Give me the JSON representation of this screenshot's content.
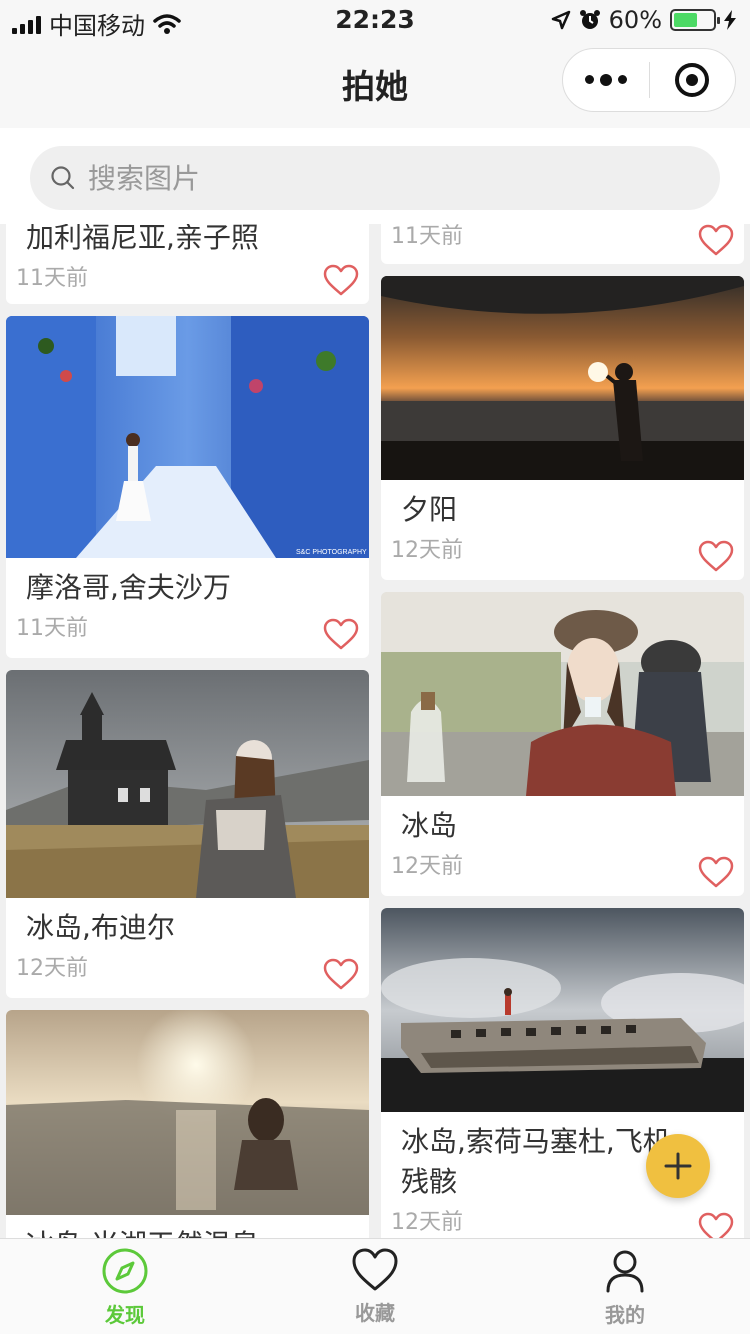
{
  "status_bar": {
    "carrier": "中国移动",
    "time": "22:23",
    "battery": "60%",
    "battery_level": 0.6
  },
  "navbar": {
    "title": "拍她"
  },
  "search": {
    "placeholder": "搜索图片"
  },
  "feed": {
    "left": [
      {
        "caption": "加利福尼亚,亲子照",
        "time": "11天前",
        "image": "partial-top"
      },
      {
        "caption": "摩洛哥,舍夫沙万",
        "time": "11天前",
        "image": "blue-city-girl-in-white-dress",
        "watermark": "S&C PHOTOGRAPHY"
      },
      {
        "caption": "冰岛,布迪尔",
        "time": "12天前",
        "image": "black-church-woman-in-sweater"
      },
      {
        "caption": "冰岛,米湖天然温泉",
        "time": "",
        "image": "woman-in-hot-spring-sunset"
      }
    ],
    "right": [
      {
        "caption": "",
        "time": "11天前",
        "image": "partial-top"
      },
      {
        "caption": "夕阳",
        "time": "12天前",
        "image": "sunset-silhouette-holding-sun"
      },
      {
        "caption": "冰岛",
        "time": "12天前",
        "image": "girl-in-cap-drinking"
      },
      {
        "caption": "冰岛,索荷马塞杜,飞机残骸",
        "time": "12天前",
        "image": "plane-wreck-on-black-sand"
      }
    ]
  },
  "fab": {
    "icon": "plus-icon"
  },
  "tabbar": {
    "tabs": [
      {
        "label": "发现",
        "icon": "compass-icon",
        "active": true
      },
      {
        "label": "收藏",
        "icon": "heart-icon",
        "active": false
      },
      {
        "label": "我的",
        "icon": "user-icon",
        "active": false
      }
    ]
  },
  "colors": {
    "accent_green": "#5cc93a",
    "fab_yellow": "#f0c040",
    "heart_red": "#e06060"
  }
}
